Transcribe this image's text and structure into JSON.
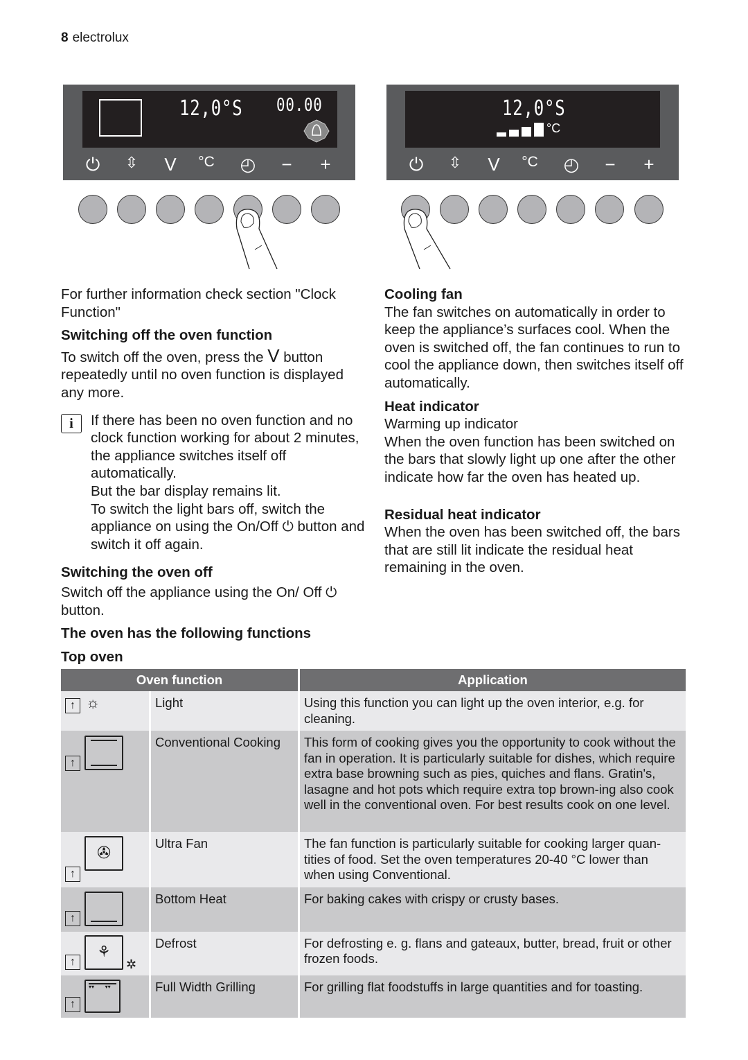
{
  "header": {
    "page_number": "8",
    "brand": "electrolux"
  },
  "panel_left": {
    "temp": "12,0°S",
    "clock": "00.00",
    "icons": [
      "power-icon",
      "function-select-icon",
      "v-icon",
      "celsius-icon",
      "clock-icon",
      "minus-icon",
      "plus-icon"
    ],
    "key_labels": [
      "V",
      "°C",
      "−",
      "+"
    ]
  },
  "panel_right": {
    "temp": "12,0°S",
    "unit": "°C"
  },
  "left_col": {
    "intro": "For further information check section \"Clock Function\"",
    "switch_off_func_title": "Switching off the oven function",
    "switch_off_func_a": "To switch off the oven, press the",
    "switch_off_func_b": "button repeatedly until no oven function is displayed any more.",
    "info_1": "If there has been no oven function and no clock function working for about 2 minutes, the appliance switches itself off automatically.",
    "info_2": "But the bar display remains lit.",
    "info_3a": "To switch the light bars off, switch the appliance on using the On/Off",
    "info_3b": "button and switch it off again.",
    "oven_off_title": "Switching the oven off",
    "oven_off_a": "Switch off the appliance using the On/ Off",
    "oven_off_b": "button.",
    "functions_title": "The oven has the following functions",
    "top_oven_title": "Top oven"
  },
  "right_col": {
    "cooling_title": "Cooling fan",
    "cooling_text": "The fan switches on automatically in order to keep the appliance’s surfaces cool. When the oven is switched off, the fan continues to run to cool the appliance down, then switches itself off automatically.",
    "heat_title": "Heat indicator",
    "heat_sub": "Warming up indicator",
    "heat_text": "When the oven function has been switched on the bars that slowly light up one after the other indicate how far the oven has heated up.",
    "residual_title": "Residual heat indicator",
    "residual_text": "When the oven has been switched off, the bars that are still lit indicate the residual heat remaining in the oven."
  },
  "table": {
    "headers": [
      "Oven function",
      "Application"
    ],
    "rows": [
      {
        "icon": "light-icon",
        "name": "Light",
        "app": "Using this function you can light up the oven interior, e.g. for cleaning."
      },
      {
        "icon": "conventional-cooking-icon",
        "name": "Conventional Cooking",
        "app": "This form of cooking gives you the opportunity to cook without the fan in operation. It is particularly suitable for dishes, which require extra base browning such as pies, quiches and flans. Gratin's, lasagne and hot pots which require extra top brown-ing also cook well in the conventional oven. For best results cook on one level."
      },
      {
        "icon": "ultra-fan-icon",
        "name": "Ultra Fan",
        "app": "The fan function is particularly suitable for cooking larger quan-tities of food. Set the oven temperatures 20-40 °C lower than when using Conventional."
      },
      {
        "icon": "bottom-heat-icon",
        "name": "Bottom Heat",
        "app": "For baking cakes with crispy or crusty bases."
      },
      {
        "icon": "defrost-icon",
        "name": "Defrost",
        "app": "For defrosting e. g. flans and gateaux, butter, bread, fruit or other frozen foods."
      },
      {
        "icon": "full-width-grilling-icon",
        "name": "Full Width Grilling",
        "app": "For grilling flat foodstuffs in large quantities and for toasting."
      }
    ]
  }
}
